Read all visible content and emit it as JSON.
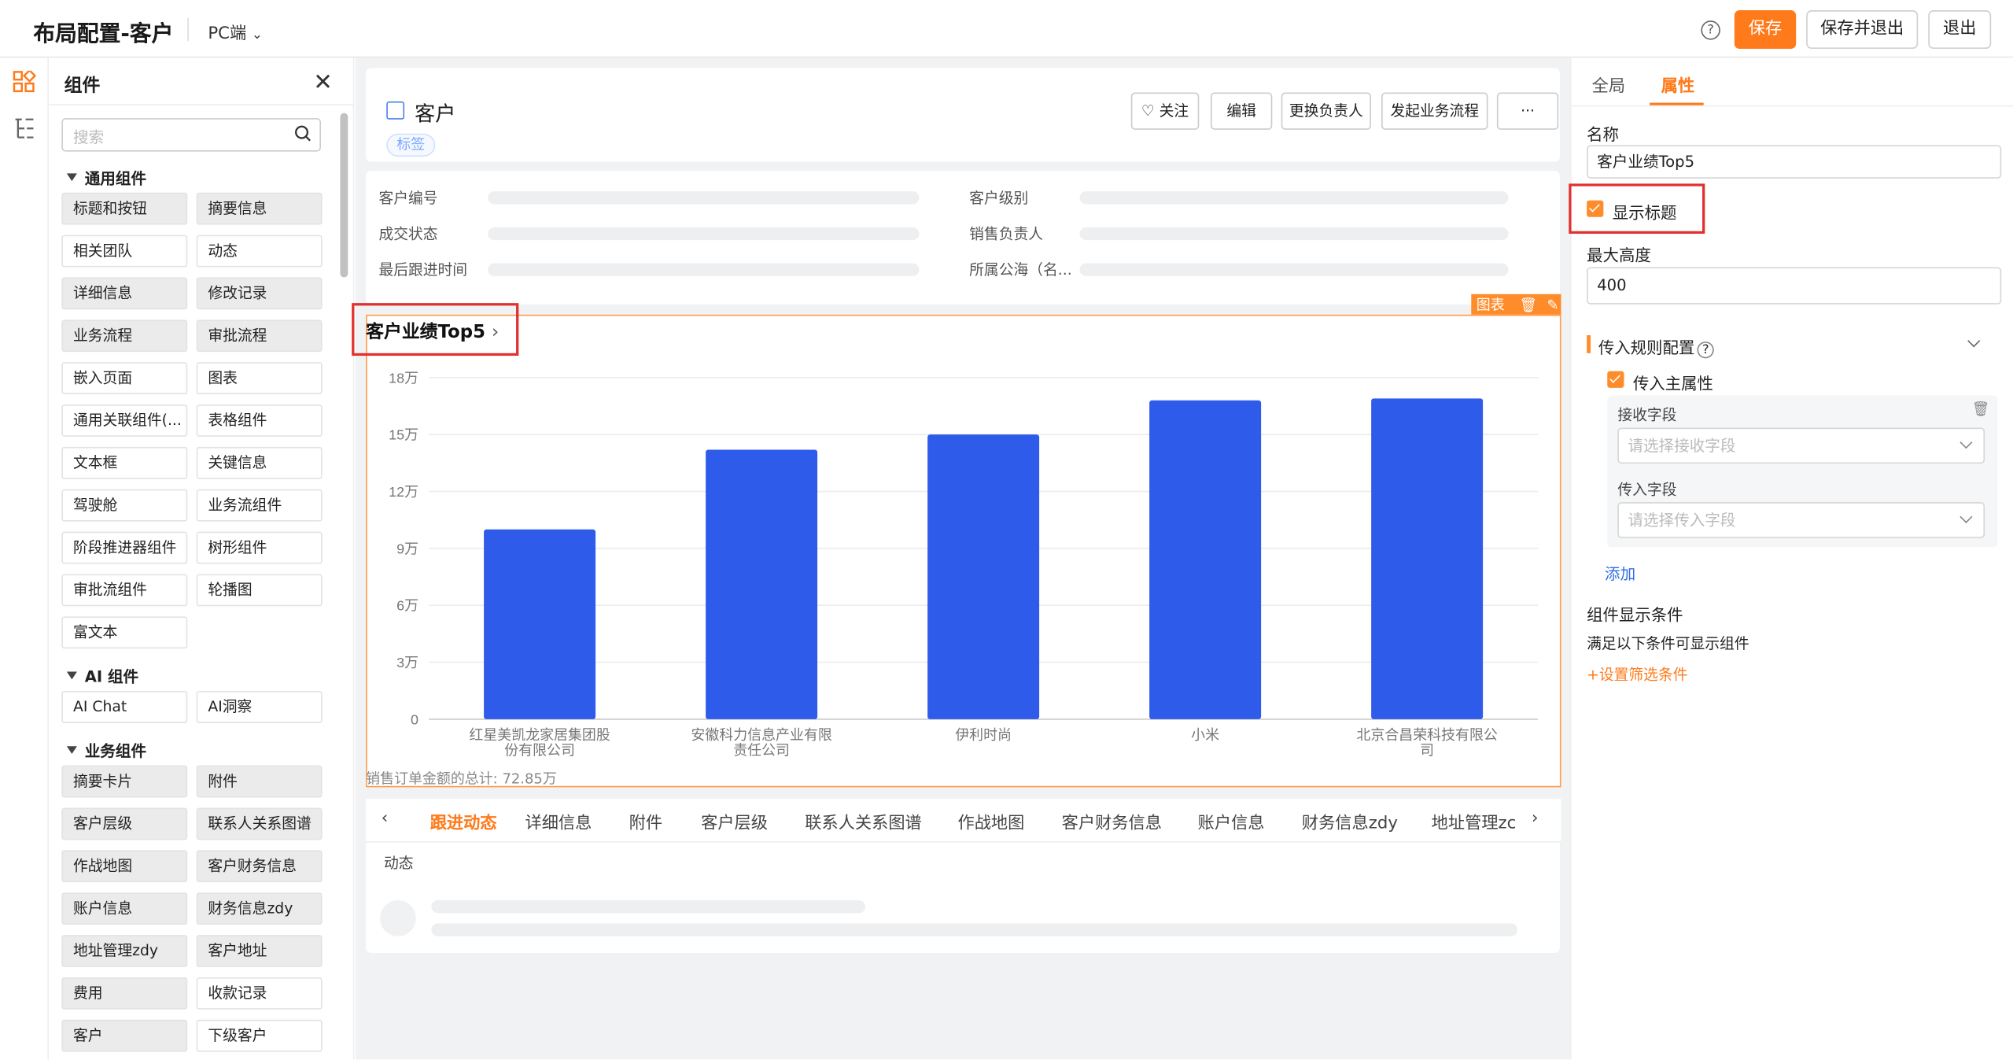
{
  "topbar": {
    "title": "布局配置-客户",
    "platform": "PC端",
    "save": "保存",
    "save_exit": "保存并退出",
    "exit": "退出",
    "help_icon": "?"
  },
  "components": {
    "header": "组件",
    "search_placeholder": "搜索",
    "groups": [
      {
        "title": "通用组件",
        "items": [
          "标题和按钮",
          "摘要信息",
          "相关团队",
          "动态",
          "详细信息",
          "修改记录",
          "业务流程",
          "审批流程",
          "嵌入页面",
          "图表",
          "通用关联组件(...",
          "表格组件",
          "文本框",
          "关键信息",
          "驾驶舱",
          "业务流组件",
          "阶段推进器组件",
          "树形组件",
          "审批流组件",
          "轮播图",
          "富文本"
        ]
      },
      {
        "title": "AI 组件",
        "items": [
          "AI Chat",
          "AI洞察"
        ]
      },
      {
        "title": "业务组件",
        "items": [
          "摘要卡片",
          "附件",
          "客户层级",
          "联系人关系图谱",
          "作战地图",
          "客户财务信息",
          "账户信息",
          "财务信息zdy",
          "地址管理zdy",
          "客户地址",
          "费用",
          "收款记录",
          "客户",
          "下级客户"
        ]
      }
    ]
  },
  "record": {
    "title": "客户",
    "tag": "标签",
    "actions": [
      "♡ 关注",
      "编辑",
      "更换负责人",
      "发起业务流程",
      "···"
    ],
    "fields": [
      "客户编号",
      "客户级别",
      "成交状态",
      "销售负责人",
      "最后跟进时间",
      "所属公海（名..."
    ]
  },
  "chart_widget": {
    "toolbar_label": "图表",
    "title": "客户业绩Top5",
    "footnote": "销售订单金额的总计: 72.85万"
  },
  "chart_data": {
    "type": "bar",
    "categories": [
      "红星美凯龙家居集团股份有限公司",
      "安徽科力信息产业有限责任公司",
      "伊利时尚",
      "小米",
      "北京合昌荣科技有限公司"
    ],
    "category_lines": [
      [
        "红星美凯龙家居集团股",
        "份有限公司"
      ],
      [
        "安徽科力信息产业有限",
        "责任公司"
      ],
      [
        "伊利时尚"
      ],
      [
        "小米"
      ],
      [
        "北京合昌荣科技有限公",
        "司"
      ]
    ],
    "values": [
      100000,
      142000,
      150000,
      168000,
      169000
    ],
    "yticks": [
      "0",
      "3万",
      "6万",
      "9万",
      "12万",
      "15万",
      "18万"
    ],
    "ylim": [
      0,
      180000
    ],
    "color": "#2f5bea"
  },
  "tabs": {
    "items": [
      "跟进动态",
      "详细信息",
      "附件",
      "客户层级",
      "联系人关系图谱",
      "作战地图",
      "客户财务信息",
      "账户信息",
      "财务信息zdy",
      "地址管理zc"
    ],
    "active": 0,
    "section": "动态"
  },
  "props": {
    "tab_global": "全局",
    "tab_attr": "属性",
    "name_label": "名称",
    "name_value": "客户业绩Top5",
    "show_title": "显示标题",
    "max_height_label": "最大高度",
    "max_height_value": "400",
    "rule_config": "传入规则配置",
    "main_attr": "传入主属性",
    "receive_field_label": "接收字段",
    "receive_field_placeholder": "请选择接收字段",
    "pass_field_label": "传入字段",
    "pass_field_placeholder": "请选择传入字段",
    "add": "添加",
    "display_condition": "组件显示条件",
    "condition_desc": "满足以下条件可显示组件",
    "set_filter": "+设置筛选条件"
  },
  "colors": {
    "accent": "#ff7a1a",
    "bar": "#2f5bea",
    "highlight": "#e03030"
  }
}
